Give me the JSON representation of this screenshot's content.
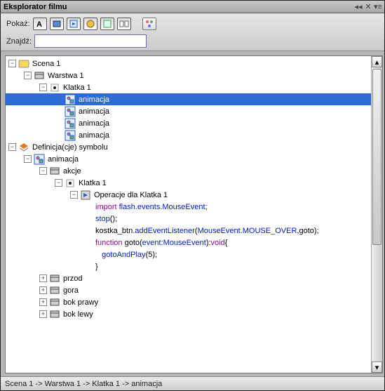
{
  "title": "Eksplorator filmu",
  "toolbar": {
    "show_label": "Pokaż:",
    "find_label": "Znajdź:",
    "find_value": ""
  },
  "tree": {
    "scene": "Scena 1",
    "layer": "Warstwa 1",
    "frame": "Klatka 1",
    "anim_items": [
      "animacja",
      "animacja",
      "animacja",
      "animacja"
    ],
    "def_section": "Definicja(cje) symbolu",
    "def_anim": "animacja",
    "actions": "akcje",
    "actions_frame": "Klatka 1",
    "ops": "Operacje dla Klatka 1",
    "code": [
      "import flash.events.MouseEvent;",
      "stop();",
      "kostka_btn.addEventListener(MouseEvent.MOUSE_OVER,goto);",
      "function goto(event:MouseEvent):void{",
      "   gotoAndPlay(5);",
      "}"
    ],
    "more": [
      "przod",
      "gora",
      "bok prawy",
      "bok lewy"
    ]
  },
  "status": "Scena 1 -> Warstwa 1 -> Klatka 1 -> animacja"
}
